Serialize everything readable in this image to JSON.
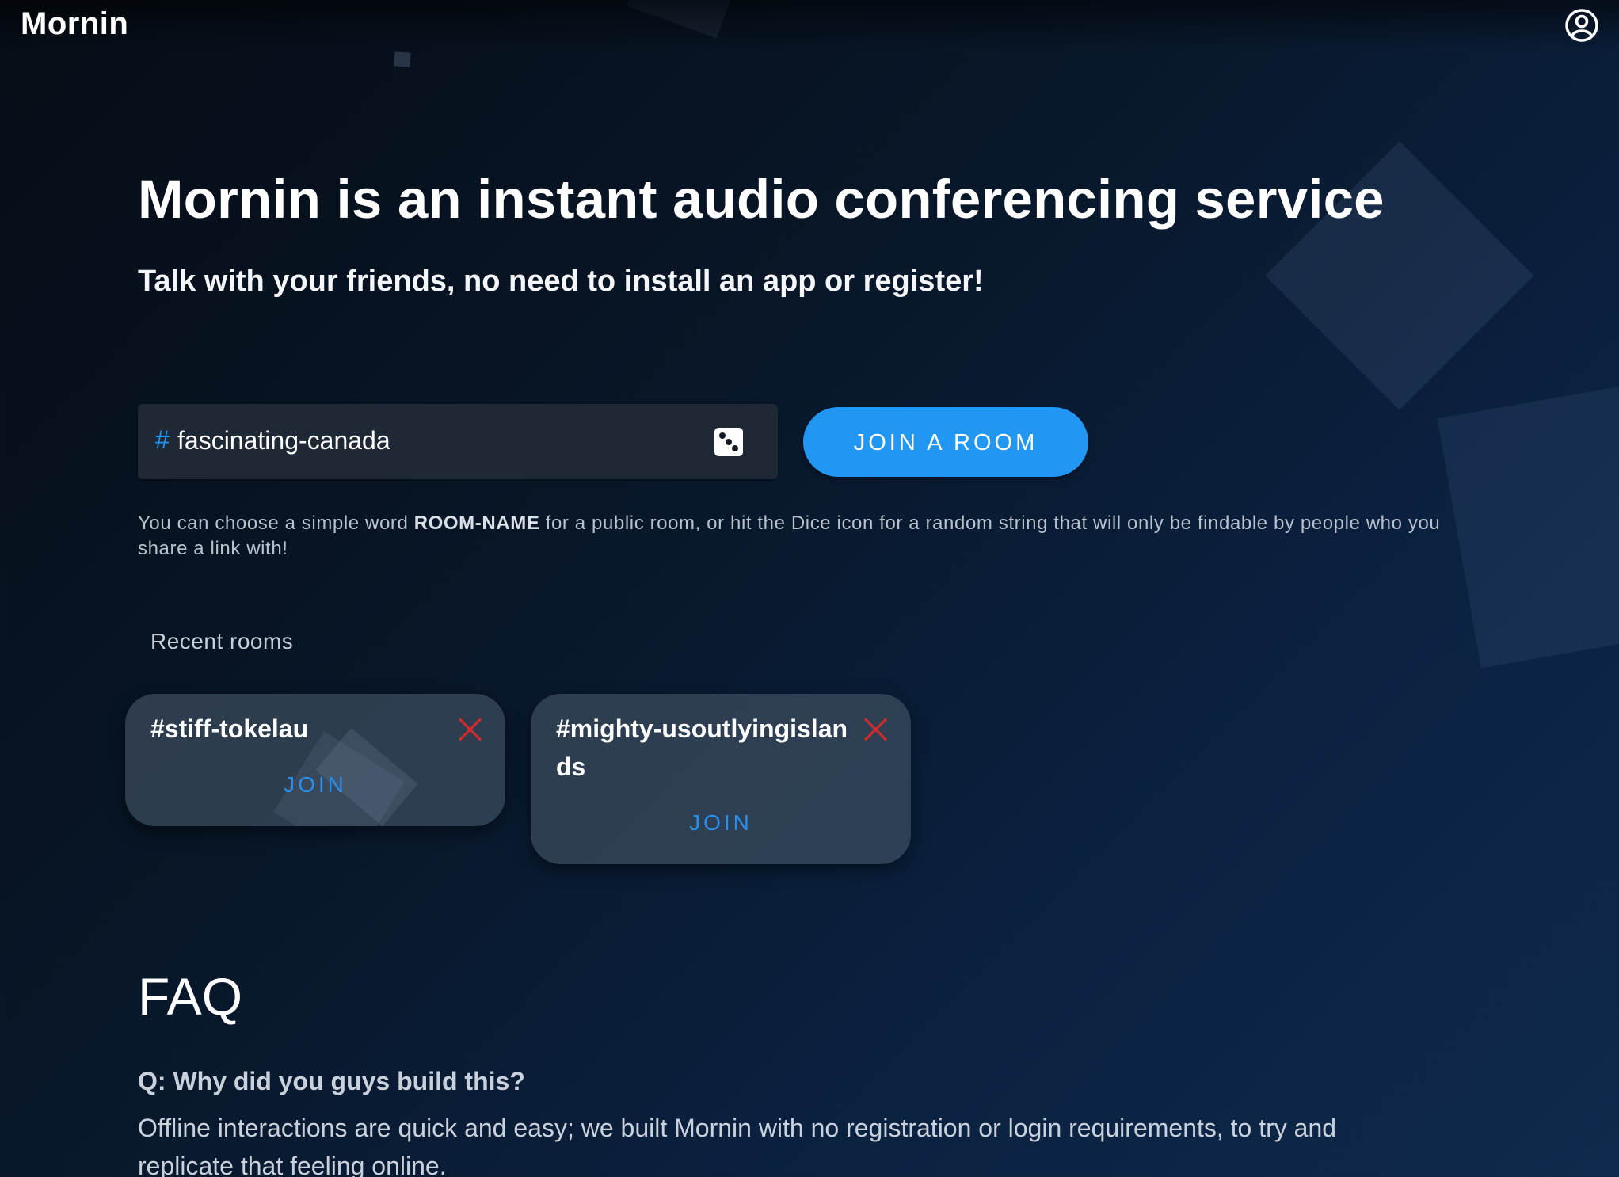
{
  "header": {
    "logo": "Mornin",
    "account_icon": "account-circle-icon"
  },
  "hero": {
    "title": "Mornin is an instant audio conferencing service",
    "subtitle": "Talk with your friends, no need to install an app or register!"
  },
  "room_input": {
    "prefix": "#",
    "value": "fascinating-canada",
    "dice_icon": "dice-icon"
  },
  "join_button": {
    "label": "JOIN A ROOM"
  },
  "hint": {
    "before": "You can choose a simple word ",
    "keyword": "ROOM-NAME",
    "after": " for a public room, or hit the Dice icon for a random string that will only be findable by people who you share a link with!"
  },
  "recent_rooms": {
    "label": "Recent rooms",
    "items": [
      {
        "name": "#stiff-tokelau",
        "join_label": "JOIN",
        "close_icon": "close-icon"
      },
      {
        "name": "#mighty-usoutlyingislands",
        "join_label": "JOIN",
        "close_icon": "close-icon"
      }
    ]
  },
  "faq": {
    "title": "FAQ",
    "question": "Q: Why did you guys build this?",
    "answer": "Offline interactions are quick and easy; we built Mornin with no registration or login requirements, to try and replicate that feeling online."
  },
  "colors": {
    "accent": "#2196f3",
    "close": "#d62a2a",
    "card": "#465568"
  }
}
